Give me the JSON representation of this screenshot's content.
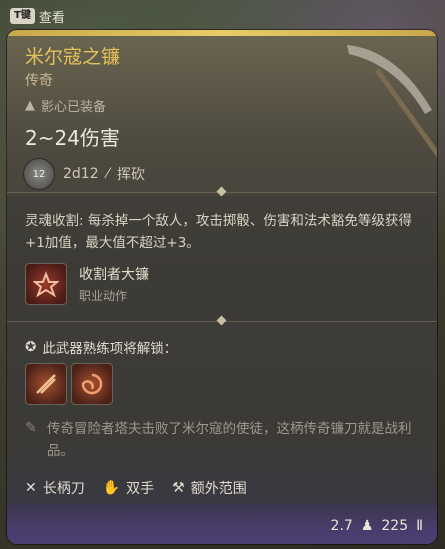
{
  "tooltip_toggle": {
    "key": "T键",
    "label": "查看"
  },
  "item": {
    "name": "米尔寇之镰",
    "rarity": "传奇",
    "equipped_text": "影心已装备",
    "damage": "2~24伤害",
    "dice_badge": "12",
    "dice": "2d12",
    "attack_type": "挥砍",
    "description": "灵魂收割: 每杀掉一个敌人，攻击掷骰、伤害和法术豁免等级获得+1加值，最大值不超过+3。",
    "action": {
      "title": "收割者大镰",
      "subtitle": "职业动作"
    },
    "proficiency_heading": "此武器熟练项将解锁：",
    "flavor": "传奇冒险者塔夫击败了米尔寇的使徒，这柄传奇镰刀就是战利品。",
    "properties": [
      "长柄刀",
      "双手",
      "额外范围"
    ],
    "weight": "2.7",
    "value": "225"
  },
  "colors": {
    "title": "#e6c25a",
    "rarity_bar": "#c8a848",
    "footer": "#4e3e78"
  }
}
